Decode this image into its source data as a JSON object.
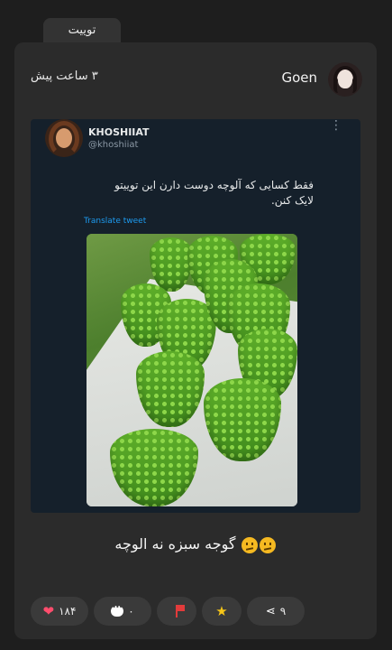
{
  "tab": {
    "label": "توییت"
  },
  "post": {
    "username": "Goen",
    "time": "۳ ساعت پیش",
    "body_text": "گوجه سبزه نه الوچه",
    "emoji": [
      "confused-face-icon",
      "confused-face-icon"
    ]
  },
  "embedded_tweet": {
    "name": "KHOSHIIAT",
    "handle": "@khoshiiat",
    "text": "فقط کسایی که آلوچه دوست دارن این توییتو لایک کنن.",
    "translate_label": "Translate tweet",
    "more_icon": "more-vertical-icon"
  },
  "actions": {
    "likes": "۱۸۴",
    "comments": "۰",
    "shares": "۹",
    "icons": [
      "heart-icon",
      "comment-icon",
      "flag-icon",
      "star-icon",
      "share-icon"
    ]
  },
  "colors": {
    "heart": "#ff4d6d",
    "flag": "#e23b3b",
    "star": "#f5c518",
    "link": "#1d9bf0"
  }
}
